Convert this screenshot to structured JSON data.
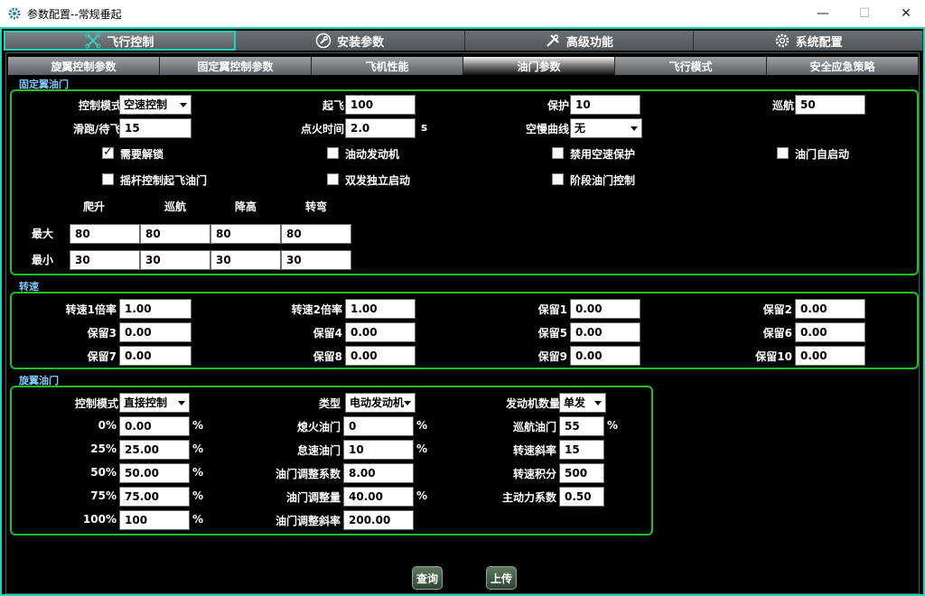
{
  "window": {
    "title": "参数配置--常规垂起",
    "min": "—",
    "max": "☐",
    "close": "✕"
  },
  "main_tabs": [
    {
      "label": "飞行控制",
      "icon": "drone-icon"
    },
    {
      "label": "安装参数",
      "icon": "wrench-circle-icon"
    },
    {
      "label": "高级功能",
      "icon": "tools-icon"
    },
    {
      "label": "系统配置",
      "icon": "gear-icon"
    }
  ],
  "sub_tabs": [
    "旋翼控制参数",
    "固定翼控制参数",
    "飞机性能",
    "油门参数",
    "飞行模式",
    "安全应急策略"
  ],
  "fixed_wing": {
    "section": "固定翼油门",
    "control_mode_label": "控制模式",
    "control_mode_value": "空速控制",
    "takeoff_label": "起飞",
    "takeoff_value": "100",
    "protect_label": "保护",
    "protect_value": "10",
    "cruise_label": "巡航",
    "cruise_value": "50",
    "taxi_label": "滑跑/待飞",
    "taxi_value": "15",
    "ignition_label": "点火时间",
    "ignition_value": "2.0",
    "ignition_unit": "s",
    "idle_curve_label": "空慢曲线",
    "idle_curve_value": "无",
    "checks": [
      {
        "label": "需要解锁",
        "checked": true
      },
      {
        "label": "油动发动机",
        "checked": false
      },
      {
        "label": "禁用空速保护",
        "checked": false
      },
      {
        "label": "油门自启动",
        "checked": false
      },
      {
        "label": "摇杆控制起飞油门",
        "checked": false
      },
      {
        "label": "双发独立启动",
        "checked": false
      },
      {
        "label": "阶段油门控制",
        "checked": false
      }
    ],
    "table": {
      "cols": [
        "爬升",
        "巡航",
        "降高",
        "转弯"
      ],
      "max_label": "最大",
      "max_values": [
        "80",
        "80",
        "80",
        "80"
      ],
      "min_label": "最小",
      "min_values": [
        "30",
        "30",
        "30",
        "30"
      ]
    }
  },
  "rpm": {
    "section": "转速",
    "fields": [
      {
        "label": "转速1倍率",
        "value": "1.00"
      },
      {
        "label": "转速2倍率",
        "value": "1.00"
      },
      {
        "label": "保留1",
        "value": "0.00"
      },
      {
        "label": "保留2",
        "value": "0.00"
      },
      {
        "label": "保留3",
        "value": "0.00"
      },
      {
        "label": "保留4",
        "value": "0.00"
      },
      {
        "label": "保留5",
        "value": "0.00"
      },
      {
        "label": "保留6",
        "value": "0.00"
      },
      {
        "label": "保留7",
        "value": "0.00"
      },
      {
        "label": "保留8",
        "value": "0.00"
      },
      {
        "label": "保留9",
        "value": "0.00"
      },
      {
        "label": "保留10",
        "value": "0.00"
      }
    ]
  },
  "rotor": {
    "section": "旋翼油门",
    "control_mode_label": "控制模式",
    "control_mode_value": "直接控制",
    "type_label": "类型",
    "type_value": "电动发动机",
    "engine_count_label": "发动机数量",
    "engine_count_value": "单发",
    "curve": [
      {
        "label": "0%",
        "value": "0.00",
        "unit": "%"
      },
      {
        "label": "25%",
        "value": "25.00",
        "unit": "%"
      },
      {
        "label": "50%",
        "value": "50.00",
        "unit": "%"
      },
      {
        "label": "75%",
        "value": "75.00",
        "unit": "%"
      },
      {
        "label": "100%",
        "value": "100",
        "unit": "%"
      }
    ],
    "mid": [
      {
        "label": "熄火油门",
        "value": "0",
        "unit": "%"
      },
      {
        "label": "怠速油门",
        "value": "10",
        "unit": "%"
      },
      {
        "label": "油门调整系数",
        "value": "8.00",
        "unit": ""
      },
      {
        "label": "油门调整量",
        "value": "40.00",
        "unit": "%"
      },
      {
        "label": "油门调整斜率",
        "value": "200.00",
        "unit": ""
      }
    ],
    "right": [
      {
        "label": "巡航油门",
        "value": "55",
        "unit": "%"
      },
      {
        "label": "转速斜率",
        "value": "15",
        "unit": ""
      },
      {
        "label": "转速积分",
        "value": "500",
        "unit": ""
      },
      {
        "label": "主动力系数",
        "value": "0.50",
        "unit": ""
      }
    ]
  },
  "buttons": {
    "query": "查询",
    "upload": "上传"
  },
  "colors": {
    "accent": "#1ad6b8",
    "group_border": "#22c022",
    "section_label": "#7ec8ff"
  }
}
